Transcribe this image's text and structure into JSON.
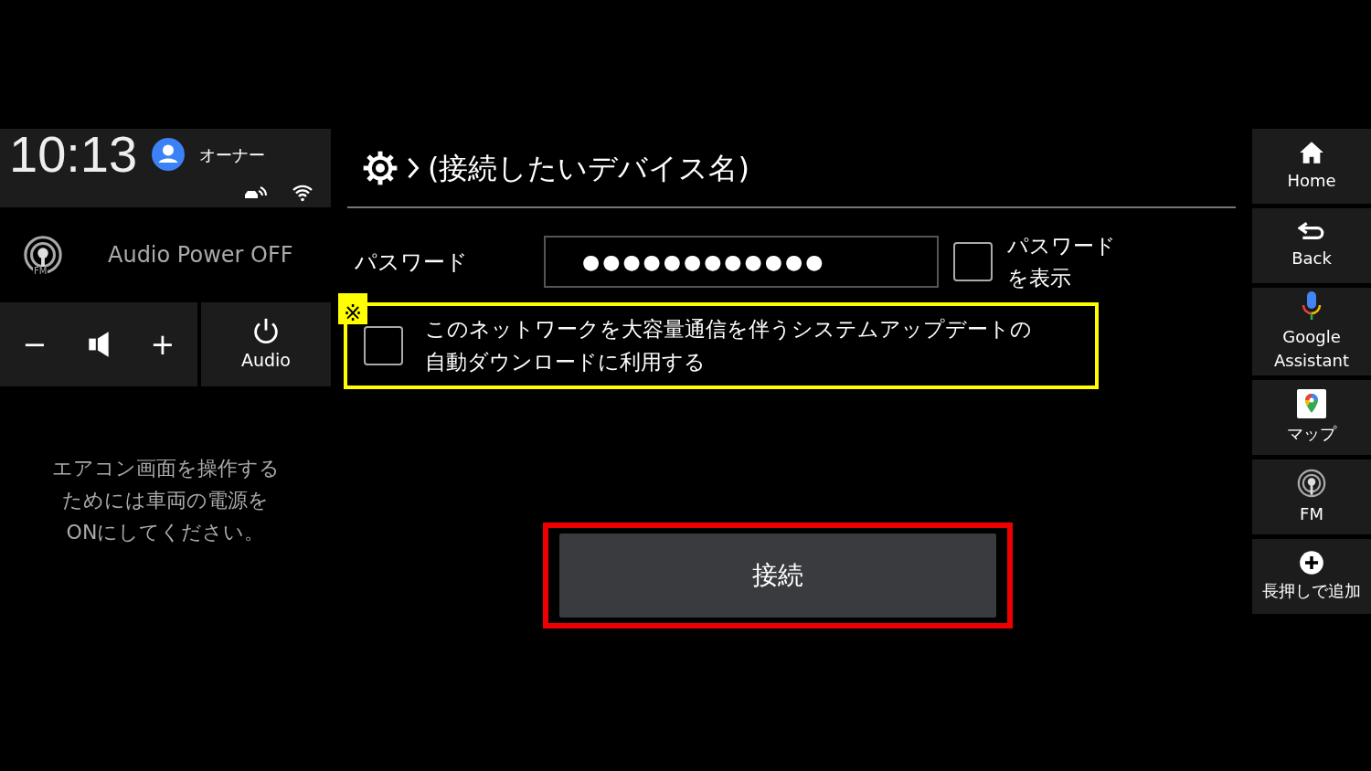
{
  "status": {
    "time": "10:13",
    "user": "オーナー"
  },
  "audio": {
    "source_badge": "FM",
    "status": "Audio Power OFF",
    "volume_down": "−",
    "volume_up": "+",
    "power_label": "Audio"
  },
  "notice_lines": [
    "エアコン画面を操作する",
    "ためには車両の電源を",
    "ONにしてください。"
  ],
  "header": {
    "title": "(接続したいデバイス名)"
  },
  "password": {
    "label": "パスワード",
    "value": "●●●●●●●●●●●●"
  },
  "show_password": {
    "label_lines": [
      "パスワード",
      "を表示"
    ],
    "checked": false
  },
  "auto_update": {
    "label_lines": [
      "このネットワークを大容量通信を伴うシステムアップデートの",
      "自動ダウンロードに利用する"
    ],
    "checked": false,
    "highlighted": true,
    "note_mark": "※"
  },
  "connect_button": {
    "label": "接続",
    "highlighted": true
  },
  "side_nav": [
    {
      "kind": "home",
      "label": "Home"
    },
    {
      "kind": "back",
      "label": "Back"
    },
    {
      "kind": "assistant",
      "label": "Google\nAssistant"
    },
    {
      "kind": "map",
      "label": "マップ"
    },
    {
      "kind": "radio",
      "label": "FM"
    },
    {
      "kind": "add",
      "label": "長押しで追加"
    }
  ]
}
